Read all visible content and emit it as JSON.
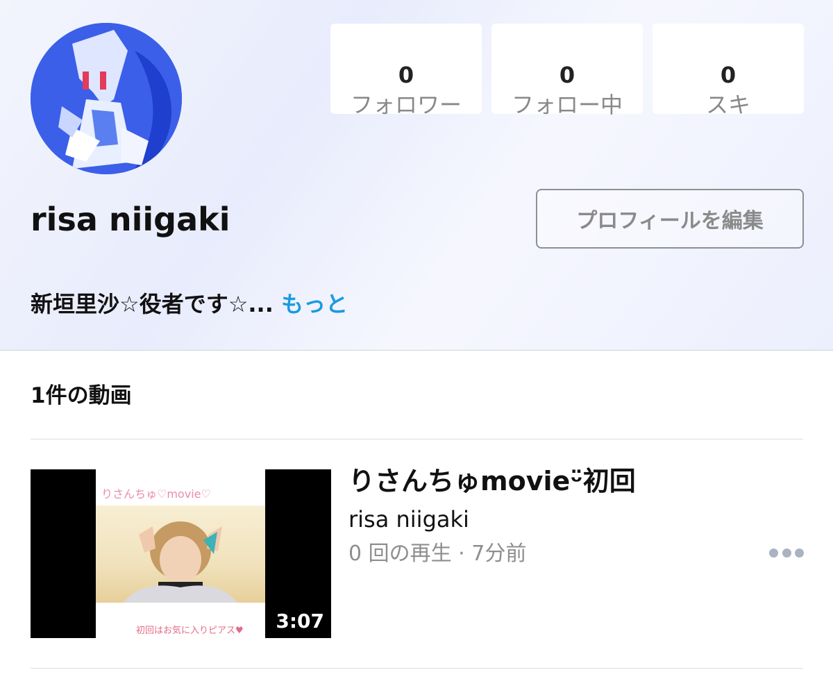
{
  "profile": {
    "name": "risa niigaki",
    "bio_text": "新垣里沙☆役者です☆...",
    "bio_more": "もっと",
    "edit_label": "プロフィールを編集"
  },
  "stats": [
    {
      "value": "0",
      "label": "フォロワー"
    },
    {
      "value": "0",
      "label": "フォロー中"
    },
    {
      "value": "0",
      "label": "スキ"
    }
  ],
  "videos_section": {
    "count_label": "1件の動画"
  },
  "videos": [
    {
      "title": "りさんちゅmovieᵕ̈初回",
      "author": "risa niigaki",
      "meta": "0 回の再生 · 7分前",
      "duration": "3:07",
      "thumb_title": "りさんちゅ♡movie♡",
      "thumb_caption": "初回はお気に入りピアス♥",
      "more_icon": "ellipsis-icon"
    }
  ]
}
